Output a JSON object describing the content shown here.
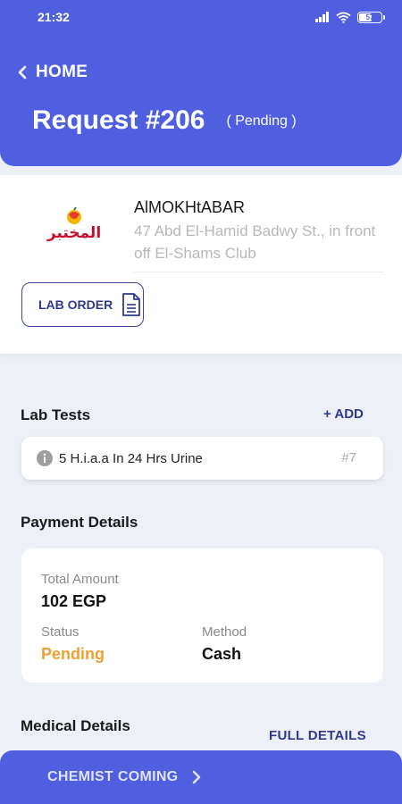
{
  "status_bar": {
    "time": "21:32",
    "battery": "57"
  },
  "header": {
    "back_label": "HOME",
    "title": "Request #206",
    "status": "( Pending )"
  },
  "lab": {
    "logo_text": "المختبر",
    "name": "AlMOKHtABAR",
    "address": "47 Abd El-Hamid Badwy St., in front off El-Shams Club",
    "order_button": "LAB ORDER"
  },
  "lab_tests": {
    "title": "Lab Tests",
    "add_label": "+ ADD",
    "items": [
      {
        "name": "5 H.i.a.a In 24 Hrs Urine",
        "number": "#7"
      }
    ]
  },
  "payment": {
    "title": "Payment Details",
    "total_label": "Total Amount",
    "total_value": "102 EGP",
    "status_label": "Status",
    "status_value": "Pending",
    "method_label": "Method",
    "method_value": "Cash"
  },
  "medical": {
    "title": "Medical Details",
    "full_details": "FULL DETAILS"
  },
  "bottom_action": {
    "label": "CHEMIST COMING"
  },
  "colors": {
    "primary": "#4f5fe0",
    "accent_text": "#2f3a8f",
    "pending": "#f0a030",
    "logo_red": "#c8102e"
  }
}
